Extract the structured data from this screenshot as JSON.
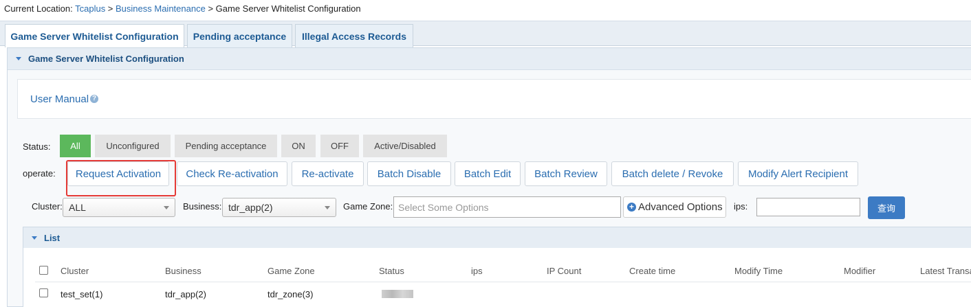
{
  "breadcrumb": {
    "prefix": "Current Location: ",
    "items": [
      "Tcaplus",
      "Business Maintenance",
      "Game Server Whitelist Configuration"
    ],
    "separator": " > "
  },
  "tabs": [
    {
      "label": "Game Server Whitelist Configuration",
      "active": true
    },
    {
      "label": "Pending acceptance",
      "active": false
    },
    {
      "label": "Illegal Access Records",
      "active": false
    }
  ],
  "panel": {
    "title": "Game Server Whitelist Configuration"
  },
  "manual": {
    "label": "User Manual"
  },
  "status": {
    "label": "Status:",
    "options": [
      "All",
      "Unconfigured",
      "Pending acceptance",
      "ON",
      "OFF",
      "Active/Disabled"
    ],
    "selected": "All"
  },
  "operate": {
    "label": "operate:",
    "buttons": [
      "Request Activation",
      "Check Re-activation",
      "Re-activate",
      "Batch Disable",
      "Batch Edit",
      "Batch Review",
      "Batch delete / Revoke",
      "Modify Alert Recipient"
    ],
    "highlighted": "Request Activation",
    "highlight_color": "#e53935"
  },
  "filters": {
    "cluster_label": "Cluster:",
    "cluster_value": "ALL",
    "business_label": "Business:",
    "business_value": "tdr_app(2)",
    "zone_label": "Game Zone:",
    "zone_placeholder": "Select Some Options",
    "advanced_label": "Advanced Options",
    "ips_label": "ips:",
    "ips_value": "",
    "query_label": "查询"
  },
  "list": {
    "title": "List",
    "columns": [
      "Cluster",
      "Business",
      "Game Zone",
      "Status",
      "ips",
      "IP Count",
      "Create time",
      "Modify Time",
      "Modifier",
      "Latest Transa"
    ],
    "rows": [
      {
        "cluster": "test_set(1)",
        "business": "tdr_app(2)",
        "zone": "tdr_zone(3)"
      }
    ]
  },
  "colors": {
    "accent": "#3c7bc4",
    "active_status": "#5cb85c",
    "link": "#2a6db0"
  }
}
